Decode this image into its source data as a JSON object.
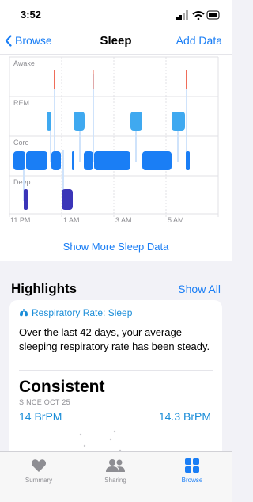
{
  "status_bar": {
    "time": "3:52"
  },
  "nav": {
    "back_label": "Browse",
    "title": "Sleep",
    "action_label": "Add Data"
  },
  "chart": {
    "stage_labels": [
      "Awake",
      "REM",
      "Core",
      "Deep"
    ],
    "time_labels": [
      "11 PM",
      "1 AM",
      "3 AM",
      "5 AM"
    ],
    "colors": {
      "awake": "#ef6d5a",
      "rem": "#3fa9f0",
      "core": "#1a7ef5",
      "deep": "#3b35b8"
    },
    "show_more_label": "Show More Sleep Data"
  },
  "highlights": {
    "heading": "Highlights",
    "show_all_label": "Show All",
    "card": {
      "category": "Respiratory Rate: Sleep",
      "text": "Over the last 42 days, your average sleeping respiratory rate has been steady.",
      "status": "Consistent",
      "since": "SINCE OCT 25",
      "value_left": "14 BrPM",
      "value_right": "14.3 BrPM"
    }
  },
  "tabbar": {
    "tabs": [
      {
        "label": "Summary"
      },
      {
        "label": "Sharing"
      },
      {
        "label": "Browse"
      }
    ]
  },
  "accent_color": "#1a7ef5"
}
